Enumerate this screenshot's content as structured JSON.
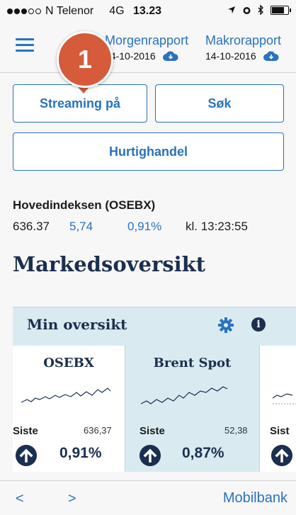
{
  "status_bar": {
    "carrier": "N Telenor",
    "network": "4G",
    "time": "13.23",
    "signal_dots_filled": 3,
    "signal_dots_total": 5,
    "battery_level": 0.7
  },
  "header": {
    "menu_icon": "hamburger-icon",
    "morgenrapport": {
      "title": "Morgenrapport",
      "date": "14-10-2016",
      "icon": "cloud-download-icon"
    },
    "makrorapport": {
      "title": "Makrorapport",
      "date": "14-10-2016",
      "icon": "cloud-download-icon"
    }
  },
  "badge": {
    "number": "1"
  },
  "buttons": {
    "streaming": "Streaming på",
    "sok": "Søk",
    "hurtighandel": "Hurtighandel"
  },
  "index": {
    "title": "Hovedindeksen (OSEBX)",
    "value": "636.37",
    "change": "5,74",
    "percent": "0,91%",
    "time": "kl. 13:23:55"
  },
  "section_title": "Markedsoversikt",
  "panel": {
    "title": "Min oversikt",
    "cards": [
      {
        "name": "OSEBX",
        "siste_label": "Siste",
        "siste_value": "636,37",
        "percent": "0,91%"
      },
      {
        "name": "Brent Spot",
        "siste_label": "Siste",
        "siste_value": "52,38",
        "percent": "0,87%"
      },
      {
        "name": "",
        "siste_label": "Sist",
        "siste_value": "",
        "percent": ""
      }
    ]
  },
  "bottom_bar": {
    "back": "<",
    "forward": ">",
    "mobilbank": "Mobilbank"
  },
  "colors": {
    "accent": "#2a72bd",
    "navy": "#1b2f4f",
    "badge": "#d55b3a",
    "panel_bg": "#d9ebf1"
  }
}
